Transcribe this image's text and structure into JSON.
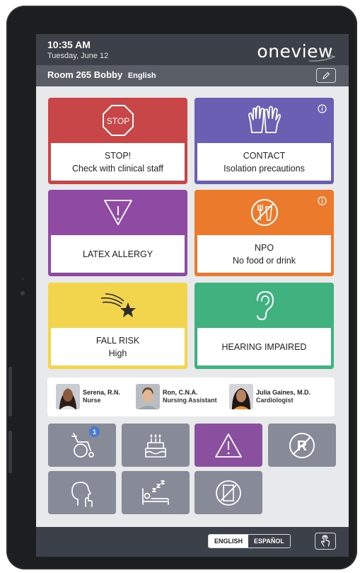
{
  "header": {
    "time": "10:35 AM",
    "date": "Tuesday, June 12",
    "logo": "oneview"
  },
  "room_bar": {
    "room": "Room 265",
    "patient": "Bobby",
    "language": "English",
    "edit_icon": "pencil-icon"
  },
  "alert_cards": [
    {
      "icon": "stop-sign-icon",
      "line1": "STOP!",
      "line2": "Check with clinical staff",
      "color": "#c94648",
      "info": false
    },
    {
      "icon": "gloves-icon",
      "line1": "CONTACT",
      "line2": "Isolation precautions",
      "color": "#6a5fb3",
      "info": true
    },
    {
      "icon": "warning-triangle-icon",
      "line1": "LATEX ALLERGY",
      "line2": "",
      "color": "#8f4aa3",
      "info": false
    },
    {
      "icon": "no-food-icon",
      "line1": "NPO",
      "line2": "No food or drink",
      "color": "#ec7a2c",
      "info": true
    },
    {
      "icon": "falling-star-icon",
      "line1": "FALL RISK",
      "line2": "High",
      "color": "#f2d54c",
      "info": false
    },
    {
      "icon": "ear-icon",
      "line1": "HEARING IMPAIRED",
      "line2": "",
      "color": "#3fb27f",
      "info": false
    }
  ],
  "care_team": [
    {
      "name": "Serena, R.N.",
      "role": "Nurse"
    },
    {
      "name": "Ron, C.N.A.",
      "role": "Nursing Assistant"
    },
    {
      "name": "Julia Gaines, M.D.",
      "role": "Cardiologist"
    }
  ],
  "quick_tiles": [
    {
      "icon": "wheelchair-icon",
      "badge": "1"
    },
    {
      "icon": "birthday-cake-icon"
    },
    {
      "icon": "warning-triangle-icon"
    },
    {
      "icon": "no-restraints-icon"
    },
    {
      "icon": "speech-head-icon"
    },
    {
      "icon": "sleeping-bed-icon"
    },
    {
      "icon": "no-door-icon"
    }
  ],
  "footer": {
    "lang_english": "ENGLISH",
    "lang_spanish": "ESPAÑOL",
    "help_icon": "hand-tap-icon"
  },
  "colors": {
    "topbar": "#3c4048",
    "room_bar": "#595e66",
    "tile_gray": "#878a97",
    "tile_purple": "#8a4f9f",
    "badge_blue": "#4a7bd1"
  }
}
